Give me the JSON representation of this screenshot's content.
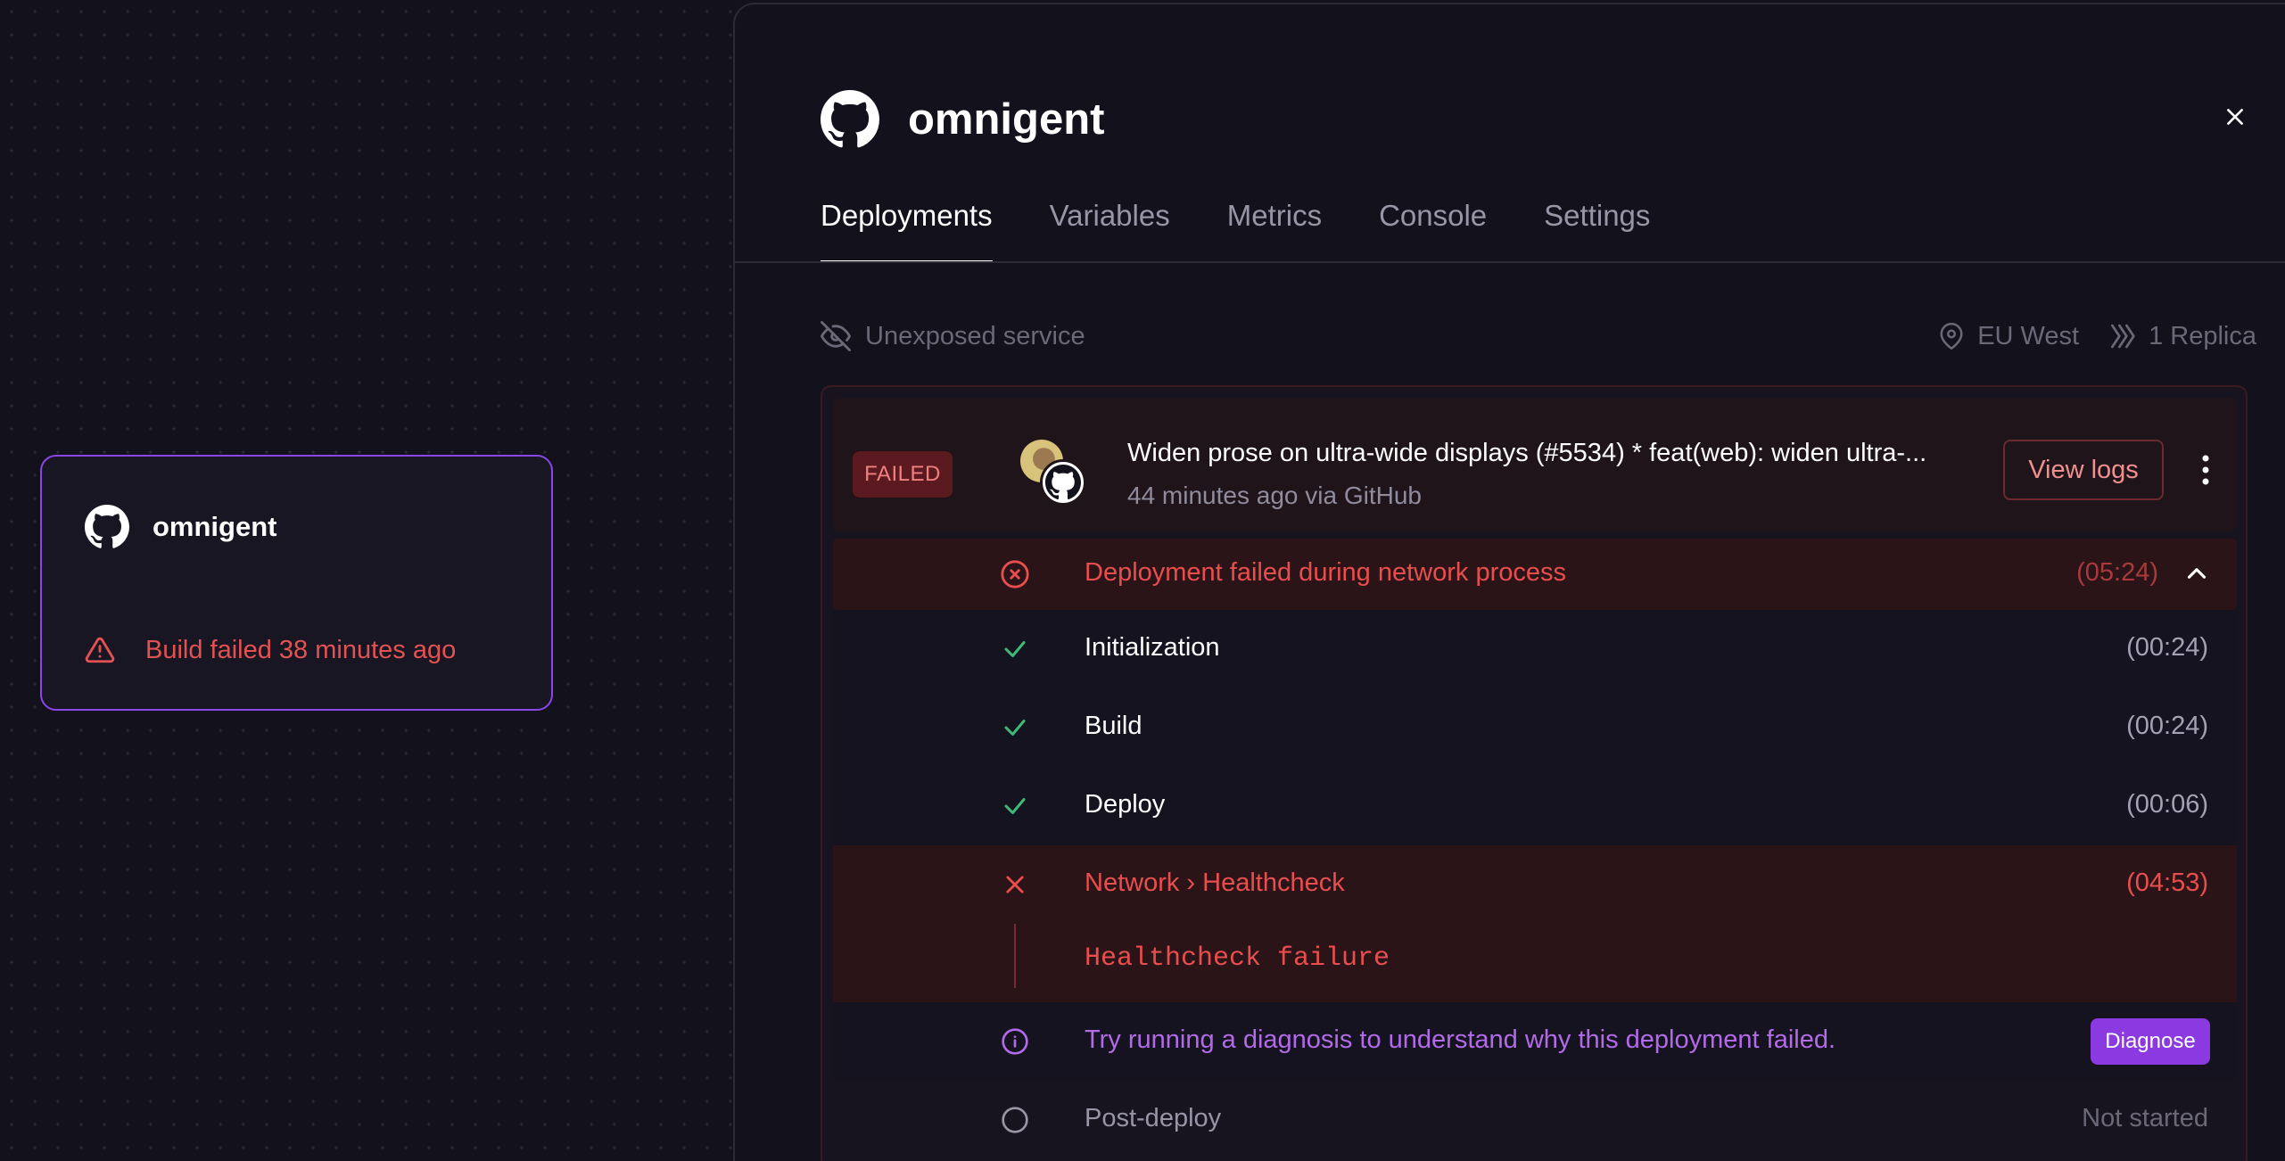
{
  "canvas": {
    "service_card": {
      "name": "omnigent",
      "status_text": "Build failed 38 minutes ago",
      "icon": "github-icon",
      "status_icon": "warning-triangle-icon"
    }
  },
  "panel": {
    "title": "omnigent",
    "icon": "github-icon",
    "close_icon": "close-icon",
    "tabs": [
      {
        "label": "Deployments",
        "active": true
      },
      {
        "label": "Variables",
        "active": false
      },
      {
        "label": "Metrics",
        "active": false
      },
      {
        "label": "Console",
        "active": false
      },
      {
        "label": "Settings",
        "active": false
      }
    ],
    "meta": {
      "exposure": "Unexposed service",
      "region": "EU West",
      "replicas": "1 Replica"
    }
  },
  "deployment": {
    "status": "FAILED",
    "commit_title": "Widen prose on ultra-wide displays (#5534) * feat(web): widen ultra-...",
    "commit_meta": "44 minutes ago via GitHub",
    "view_logs_label": "View logs",
    "summary": {
      "text": "Deployment failed during network process",
      "time": "(05:24)"
    },
    "steps": [
      {
        "label": "Initialization",
        "time": "(00:24)",
        "state": "success"
      },
      {
        "label": "Build",
        "time": "(00:24)",
        "state": "success"
      },
      {
        "label": "Deploy",
        "time": "(00:06)",
        "state": "success"
      }
    ],
    "failed_step": {
      "label": "Network › Healthcheck",
      "time": "(04:53)",
      "message": "Healthcheck failure"
    },
    "hint": {
      "text": "Try running a diagnosis to understand why this deployment failed.",
      "button": "Diagnose"
    },
    "post_deploy": {
      "label": "Post-deploy",
      "status": "Not started"
    }
  },
  "colors": {
    "background": "#13111c",
    "accent_purple": "#8a3ae0",
    "error_red": "#e84e4e",
    "success_green": "#3fb97a"
  }
}
